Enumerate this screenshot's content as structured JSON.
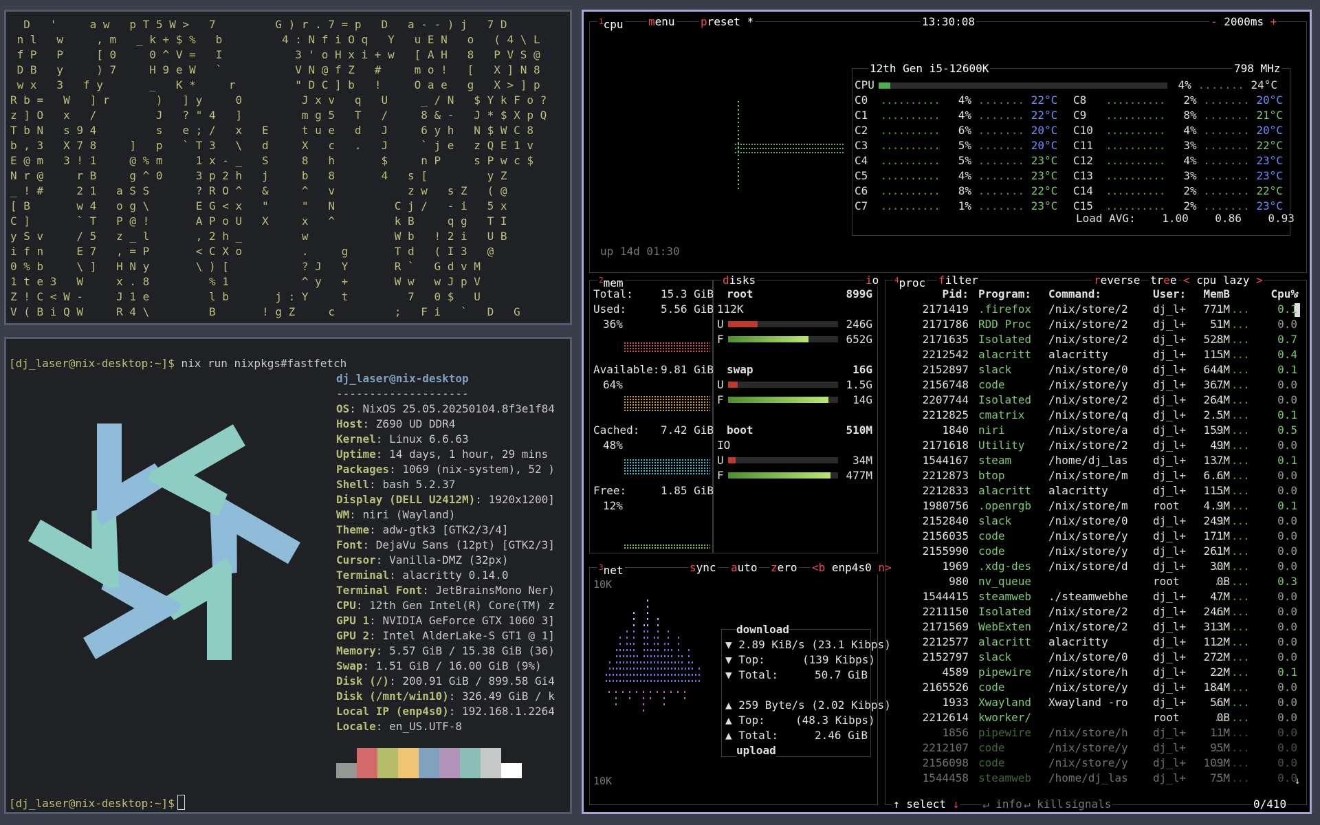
{
  "matrix": {
    "lines": [
      "  D   '     a w   p T 5 W >   7         G ) r . 7 = p   D   a - - ) j   7 D",
      " n l   w     , m   _ k + $ %   b         4 : N f i O q   Y   u E N   o   ( 4 \\ L",
      " f P   P     [ 0     0 ^ V =   I           3 ' o H x i + w   [ A H   8   P V S @",
      " D B   y     ) 7     H 9 e W   `           V N @ f Z   #     m o !   [   X ] N 8",
      " w x   3   f y       _   K *     r         \" D C ] b   !     O a e   g   X > ] p",
      "R b =   W   ] r       )   ] y     0         J x v   q   U     _ / N   $ Y k F o ?",
      "z ] O   x   /         J   ? \" 4   ]         m g 5   T   /     8 & -   J * $ X p Q",
      "T b N   s 9 4         s   e ; /   x   E     t u e   d   J     6 y h   N $ W C 8",
      "b , 3   X 7 8     ]   p   ` T 3   \\   d     X   c   .   J     ` j e   z Q E 1 v",
      "E @ m   3 ! 1     @ % m     1 x - _   S     8   h       $     n P     s P w c $",
      "N r @     r B     g ^ 0     3 p 2 h   j     b   8       4   s [         y Z",
      "_ ! #     2 1   a S S       ? R O ^   &     ^   v           z w   s Z   ( @",
      "[ B       w 4   o g \\       E G < x   \"     \"   N         C j /   - i   5 x",
      "C ]       ` T   P @ !       A P o U   X     x   ^         k B     q g   T I",
      "y S v     / 5   z _ l       , 2 h _         w             W b   ! 2 i   U B",
      "i f n     E 7   , = P       < C X o         .     g       T d   ( I 3   @",
      "0 % b     \\ ]   H N y       \\ ) [           ? J   Y       R `   G d v M",
      "1 t e 3   W     x . 8         % 1           ^ y   +       W w   w J p V",
      "Z ! C < W -     J 1 e         l b       j : Y     t         7   0 $   U",
      "V ( B i Q W     R 4 \\         B       ! g Z     c         ;   F i   `   D   G"
    ]
  },
  "fastfetch": {
    "prompt": "[dj_laser@nix-desktop:~]$",
    "command": "nix run nixpkgs#fastfetch",
    "userhost": "dj_laser@nix-desktop",
    "separator": "--------------------",
    "rows": [
      {
        "key": "OS",
        "val": ": NixOS 25.05.20250104.8f3e1f84"
      },
      {
        "key": "Host",
        "val": ": Z690 UD DDR4"
      },
      {
        "key": "Kernel",
        "val": ": Linux 6.6.63"
      },
      {
        "key": "Uptime",
        "val": ": 14 days, 1 hour, 29 mins"
      },
      {
        "key": "Packages",
        "val": ": 1069 (nix-system), 52 )"
      },
      {
        "key": "Shell",
        "val": ": bash 5.2.37"
      },
      {
        "key": "Display (DELL U2412M)",
        "val": ": 1920x1200]"
      },
      {
        "key": "WM",
        "val": ": niri (Wayland)"
      },
      {
        "key": "Theme",
        "val": ": adw-gtk3 [GTK2/3/4]"
      },
      {
        "key": "Font",
        "val": ": DejaVu Sans (12pt) [GTK2/3]"
      },
      {
        "key": "Cursor",
        "val": ": Vanilla-DMZ (32px)"
      },
      {
        "key": "Terminal",
        "val": ": alacritty 0.14.0"
      },
      {
        "key": "Terminal Font",
        "val": ": JetBrainsMono Ner)"
      },
      {
        "key": "CPU",
        "val": ": 12th Gen Intel(R) Core(TM) z"
      },
      {
        "key": "GPU 1",
        "val": ": NVIDIA GeForce GTX 1060 3]"
      },
      {
        "key": "GPU 2",
        "val": ": Intel AlderLake-S GT1 @ 1]"
      },
      {
        "key": "Memory",
        "val": ": 5.57 GiB / 15.38 GiB (36)"
      },
      {
        "key": "Swap",
        "val": ": 1.51 GiB / 16.00 GiB (9%)"
      },
      {
        "key": "Disk (/)",
        "val": ": 200.91 GiB / 899.58 Gi4"
      },
      {
        "key": "Disk (/mnt/win10)",
        "val": ": 326.49 GiB / k"
      },
      {
        "key": "Local IP (enp4s0)",
        "val": ": 192.168.1.2264"
      },
      {
        "key": "Locale",
        "val": ": en_US.UTF-8"
      }
    ],
    "palette": [
      "#202124",
      "#d46b6b",
      "#b5bd68",
      "#f0c674",
      "#81a2be",
      "#b294bb",
      "#8abeb7",
      "#c5c8c6",
      "#969896",
      "#ffffff"
    ],
    "bottom_prompt": "[dj_laser@nix-desktop:~]$"
  },
  "btop": {
    "cpu_box": {
      "title_num": "1",
      "title": "cpu",
      "menu": "menu",
      "preset": "preset *",
      "clock": "13:30:08",
      "interval": "- 2000ms +",
      "cpu_name": "12th Gen i5-12600K",
      "freq": "798 MHz",
      "uptime": "up 14d 01:30",
      "total": {
        "label": "CPU",
        "pct": "4%",
        "temp": "24°C"
      },
      "cores_left": [
        {
          "label": "C0",
          "pct": "4%",
          "temp": "22°C",
          "hot": false
        },
        {
          "label": "C1",
          "pct": "4%",
          "temp": "22°C",
          "hot": false
        },
        {
          "label": "C2",
          "pct": "6%",
          "temp": "20°C",
          "hot": false
        },
        {
          "label": "C3",
          "pct": "5%",
          "temp": "20°C",
          "hot": false
        },
        {
          "label": "C4",
          "pct": "5%",
          "temp": "23°C",
          "hot": true
        },
        {
          "label": "C5",
          "pct": "4%",
          "temp": "23°C",
          "hot": true
        },
        {
          "label": "C6",
          "pct": "8%",
          "temp": "22°C",
          "hot": true
        },
        {
          "label": "C7",
          "pct": "1%",
          "temp": "23°C",
          "hot": true
        }
      ],
      "cores_right": [
        {
          "label": "C8",
          "pct": "2%",
          "temp": "20°C",
          "hot": false
        },
        {
          "label": "C9",
          "pct": "8%",
          "temp": "21°C",
          "hot": true
        },
        {
          "label": "C10",
          "pct": "4%",
          "temp": "20°C",
          "hot": false
        },
        {
          "label": "C11",
          "pct": "3%",
          "temp": "22°C",
          "hot": true
        },
        {
          "label": "C12",
          "pct": "4%",
          "temp": "23°C",
          "hot": false
        },
        {
          "label": "C13",
          "pct": "3%",
          "temp": "23°C",
          "hot": false
        },
        {
          "label": "C14",
          "pct": "2%",
          "temp": "22°C",
          "hot": true
        },
        {
          "label": "C15",
          "pct": "2%",
          "temp": "23°C",
          "hot": false
        }
      ],
      "load_label": "Load AVG:",
      "load": [
        "1.00",
        "0.86",
        "0.93"
      ]
    },
    "mem_box": {
      "title_num": "2",
      "title": "mem",
      "total_label": "Total:",
      "total": "15.3 GiB",
      "used_label": "Used:",
      "used": "5.56 GiB",
      "used_pct": "36%",
      "avail_label": "Available:",
      "avail": "9.81 GiB",
      "avail_pct": "64%",
      "cached_label": "Cached:",
      "cached": "7.42 GiB",
      "cached_pct": "48%",
      "free_label": "Free:",
      "free": "1.85 GiB",
      "free_pct": "12%"
    },
    "disks_box": {
      "title": "disks",
      "io": "io",
      "disks": [
        {
          "name": "root",
          "size": "899G",
          "io": "112K",
          "u": "246G",
          "f": "652G",
          "used_frac": 0.27
        },
        {
          "name": "swap",
          "size": "16G",
          "io": "",
          "u": "1.5G",
          "f": "14G",
          "used_frac": 0.09
        },
        {
          "name": "boot",
          "size": "510M",
          "io": "IO",
          "u": "34M",
          "f": "477M",
          "used_frac": 0.07
        }
      ]
    },
    "net_box": {
      "title_num": "3",
      "title": "net",
      "sync": "sync",
      "auto": "auto",
      "zero": "zero",
      "iface_prev": "<b",
      "iface": "enp4s0",
      "iface_next": "n>",
      "scale_top": "10K",
      "scale_bottom": "10K",
      "download_label": "download",
      "dl_rate": "▼ 2.89 KiB/s (23.1 Kibps)",
      "dl_top_label": "▼ Top:",
      "dl_top": "(139 Kibps)",
      "dl_total_label": "▼ Total:",
      "dl_total": "50.7 GiB",
      "ul_rate": "▲ 259 Byte/s (2.02 Kibps)",
      "ul_top_label": "▲ Top:",
      "ul_top": "(48.3 Kibps)",
      "ul_total_label": "▲ Total:",
      "ul_total": "2.46 GiB",
      "upload_label": "upload"
    },
    "proc_box": {
      "title_num": "4",
      "title": "proc",
      "filter": "filter",
      "reverse": "reverse",
      "tree": "tree",
      "sort_prev": "<",
      "sort": "cpu lazy",
      "sort_next": ">",
      "headers": [
        "Pid:",
        "Program:",
        "Command:",
        "User:",
        "MemB",
        "Cpu%"
      ],
      "rows": [
        [
          "2171419",
          ".firefox",
          "/nix/store/2",
          "dj_l+",
          "771M",
          "0.1"
        ],
        [
          "2171786",
          "RDD Proc",
          "/nix/store/2",
          "dj_l+",
          "51M",
          "0.0"
        ],
        [
          "2171635",
          "Isolated",
          "/nix/store/2",
          "dj_l+",
          "528M",
          "0.7"
        ],
        [
          "2212542",
          "alacritt",
          "alacritty",
          "dj_l+",
          "115M",
          "0.4"
        ],
        [
          "2152897",
          "slack",
          "/nix/store/0",
          "dj_l+",
          "644M",
          "0.1"
        ],
        [
          "2156748",
          "code",
          "/nix/store/y",
          "dj_l+",
          "367M",
          "0.0"
        ],
        [
          "2207744",
          "Isolated",
          "/nix/store/2",
          "dj_l+",
          "264M",
          "0.0"
        ],
        [
          "2212825",
          "cmatrix",
          "/nix/store/q",
          "dj_l+",
          "2.5M",
          "0.1"
        ],
        [
          "1840",
          "niri",
          "/nix/store/a",
          "dj_l+",
          "159M",
          "0.5"
        ],
        [
          "2171618",
          "Utility",
          "/nix/store/2",
          "dj_l+",
          "49M",
          "0.0"
        ],
        [
          "1544167",
          "steam",
          "/home/dj_las",
          "dj_l+",
          "137M",
          "0.1"
        ],
        [
          "2212873",
          "btop",
          "/nix/store/m",
          "dj_l+",
          "6.6M",
          "0.0"
        ],
        [
          "2212833",
          "alacritt",
          "alacritty",
          "dj_l+",
          "115M",
          "0.0"
        ],
        [
          "1980756",
          ".openrgb",
          "/nix/store/m",
          "root",
          "4.9M",
          "0.1"
        ],
        [
          "2152840",
          "slack",
          "/nix/store/0",
          "dj_l+",
          "249M",
          "0.0"
        ],
        [
          "2156035",
          "code",
          "/nix/store/y",
          "dj_l+",
          "171M",
          "0.0"
        ],
        [
          "2155990",
          "code",
          "/nix/store/y",
          "dj_l+",
          "261M",
          "0.0"
        ],
        [
          "1969",
          ".xdg-des",
          "/nix/store/d",
          "dj_l+",
          "30M",
          "0.0"
        ],
        [
          "980",
          "nv_queue",
          "",
          "root",
          "0B",
          "0.3"
        ],
        [
          "1544415",
          "steamweb",
          "./steamwebhe",
          "dj_l+",
          "47M",
          "0.0"
        ],
        [
          "2211150",
          "Isolated",
          "/nix/store/2",
          "dj_l+",
          "246M",
          "0.0"
        ],
        [
          "2171569",
          "WebExten",
          "/nix/store/2",
          "dj_l+",
          "313M",
          "0.0"
        ],
        [
          "2212577",
          "alacritt",
          "alacritty",
          "dj_l+",
          "112M",
          "0.0"
        ],
        [
          "2152797",
          "slack",
          "/nix/store/0",
          "dj_l+",
          "272M",
          "0.0"
        ],
        [
          "4589",
          "pipewire",
          "/nix/store/h",
          "dj_l+",
          "22M",
          "0.1"
        ],
        [
          "2165526",
          "code",
          "/nix/store/y",
          "dj_l+",
          "184M",
          "0.0"
        ],
        [
          "1933",
          "Xwayland",
          "Xwayland -ro",
          "dj_l+",
          "56M",
          "0.0"
        ],
        [
          "2212614",
          "kworker/",
          "",
          "root",
          "0B",
          "0.0"
        ],
        [
          "1856",
          "pipewire",
          "/nix/store/h",
          "dj_l+",
          "11M",
          "0.0"
        ],
        [
          "2212107",
          "code",
          "/nix/store/y",
          "dj_l+",
          "95M",
          "0.0"
        ],
        [
          "2156098",
          "code",
          "/nix/store/y",
          "dj_l+",
          "109M",
          "0.0"
        ],
        [
          "1544458",
          "steamweb",
          "/home/dj_las",
          "dj_l+",
          "75M",
          "0.0"
        ]
      ],
      "footer_select": "↑ select ↓",
      "footer_info": "info",
      "footer_kill": "kill",
      "footer_signals": "signals",
      "count": "0/410"
    }
  }
}
